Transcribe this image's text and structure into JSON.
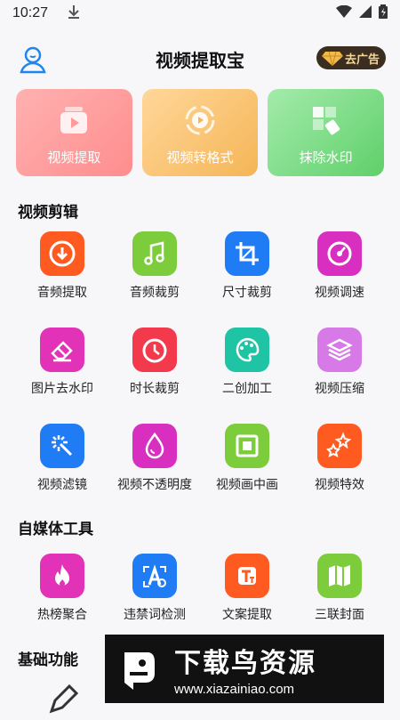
{
  "status_bar": {
    "time": "10:27"
  },
  "header": {
    "title": "视频提取宝",
    "ad_button": "去广告"
  },
  "feature_cards": [
    {
      "label": "视频提取",
      "icon": "video-play-icon"
    },
    {
      "label": "视频转格式",
      "icon": "convert-icon"
    },
    {
      "label": "抹除水印",
      "icon": "eraser-icon"
    }
  ],
  "sections": {
    "video_edit": {
      "title": "视频剪辑",
      "items": [
        {
          "label": "音频提取",
          "icon": "download-circle-icon",
          "color": "#ff5a1f"
        },
        {
          "label": "音频裁剪",
          "icon": "music-note-icon",
          "color": "#7ccc3c"
        },
        {
          "label": "尺寸裁剪",
          "icon": "crop-icon",
          "color": "#1f7cf5"
        },
        {
          "label": "视频调速",
          "icon": "speed-dial-icon",
          "color": "#d92fc0"
        },
        {
          "label": "图片去水印",
          "icon": "eraser-icon",
          "color": "#e233b8"
        },
        {
          "label": "时长裁剪",
          "icon": "clock-icon",
          "color": "#f23a4c"
        },
        {
          "label": "二创加工",
          "icon": "palette-icon",
          "color": "#1fc4a4"
        },
        {
          "label": "视频压缩",
          "icon": "layers-icon",
          "color": "#d77ae8"
        },
        {
          "label": "视频滤镜",
          "icon": "magic-wand-icon",
          "color": "#1f7cf5"
        },
        {
          "label": "视频不透明度",
          "icon": "drop-icon",
          "color": "#d92fc0"
        },
        {
          "label": "视频画中画",
          "icon": "picture-in-picture-icon",
          "color": "#7ccc3c"
        },
        {
          "label": "视频特效",
          "icon": "stars-icon",
          "color": "#ff5a1f"
        }
      ]
    },
    "media_tools": {
      "title": "自媒体工具",
      "items": [
        {
          "label": "热榜聚合",
          "icon": "flame-icon",
          "color": "#e233b8"
        },
        {
          "label": "违禁词检测",
          "icon": "scan-a-icon",
          "color": "#1f7cf5"
        },
        {
          "label": "文案提取",
          "icon": "text-t-icon",
          "color": "#ff5a1f"
        },
        {
          "label": "三联封面",
          "icon": "map-fold-icon",
          "color": "#7ccc3c"
        }
      ]
    },
    "basic": {
      "title": "基础功能"
    }
  },
  "watermark": {
    "main": "下载鸟资源",
    "url": "www.xiazainiao.com"
  }
}
